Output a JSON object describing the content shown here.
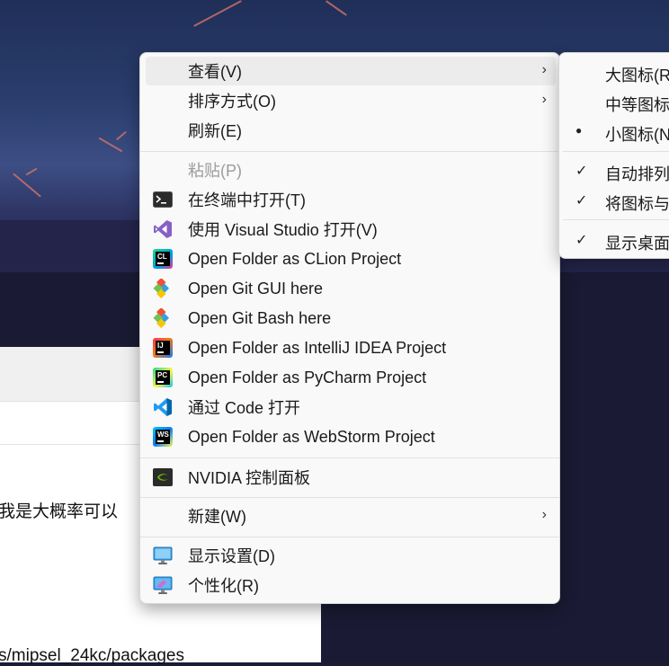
{
  "background": {
    "text_line_1": "我是大概率可以",
    "text_line_2": "s/mipsel_24kc/packages"
  },
  "context_menu": {
    "items": {
      "view": "查看(V)",
      "sort": "排序方式(O)",
      "refresh": "刷新(E)",
      "paste": "粘贴(P)",
      "terminal": "在终端中打开(T)",
      "visual_studio": "使用 Visual Studio 打开(V)",
      "clion": "Open Folder as CLion Project",
      "git_gui": "Open Git GUI here",
      "git_bash": "Open Git Bash here",
      "intellij": "Open Folder as IntelliJ IDEA Project",
      "pycharm": "Open Folder as PyCharm Project",
      "vscode": "通过 Code 打开",
      "webstorm": "Open Folder as WebStorm Project",
      "nvidia": "NVIDIA 控制面板",
      "new": "新建(W)",
      "display": "显示设置(D)",
      "personalize": "个性化(R)"
    },
    "icon_labels": {
      "clion": "CL",
      "intellij": "IJ",
      "pycharm": "PC",
      "webstorm": "WS"
    },
    "chevron": "›"
  },
  "view_submenu": {
    "large_icons": "大图标(R",
    "medium_icons": "中等图标",
    "small_icons": "小图标(N",
    "auto_arrange": "自动排列",
    "align_grid": "将图标与",
    "show_desktop_icons": "显示桌面",
    "bullet": "●",
    "check": "✓"
  },
  "colors": {
    "menu_bg": "#f9f9f9",
    "hover_bg": "#ececec",
    "disabled_text": "#9b9b9b",
    "vs_purple": "#8661c5",
    "vscode_blue": "#1f9cf0",
    "git_red": "#f05033",
    "nvidia_green": "#76b900"
  }
}
